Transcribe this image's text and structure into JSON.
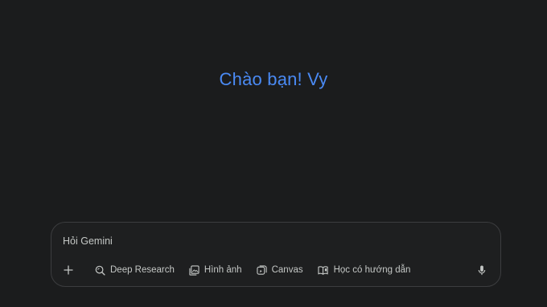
{
  "greeting": "Chào bạn! Vy",
  "colors": {
    "accent": "#4a8af4",
    "background": "#1b1c1d",
    "muted_text": "#c4c7c5"
  },
  "composer": {
    "placeholder": "Hỏi Gemini",
    "add_icon": "plus-icon",
    "tools": [
      {
        "label": "Deep Research",
        "icon": "deep-research-icon"
      },
      {
        "label": "Hình ảnh",
        "icon": "image-icon"
      },
      {
        "label": "Canvas",
        "icon": "canvas-icon"
      },
      {
        "label": "Học có hướng dẫn",
        "icon": "guided-learning-icon"
      }
    ],
    "mic_icon": "microphone-icon"
  }
}
